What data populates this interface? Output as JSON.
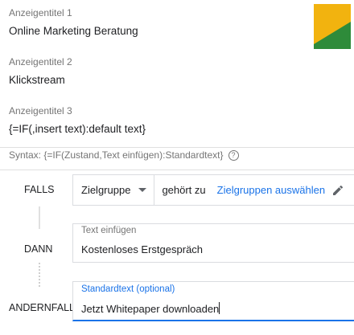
{
  "headlines": [
    {
      "label": "Anzeigentitel 1",
      "value": "Online Marketing Beratung"
    },
    {
      "label": "Anzeigentitel 2",
      "value": "Klickstream"
    },
    {
      "label": "Anzeigentitel 3",
      "value": "{=IF(,insert text):default text}"
    }
  ],
  "syntax": {
    "text": "Syntax: {=IF(Zustand,Text einfügen):Standardtext}",
    "help_icon": "help-circle-icon"
  },
  "falls": {
    "label": "FALLS",
    "dropdown_value": "Zielgruppe",
    "connector": "gehört zu",
    "link": "Zielgruppen auswählen",
    "edit_icon": "pencil-icon"
  },
  "dann": {
    "label": "DANN",
    "placeholder": "Text einfügen",
    "value": "Kostenloses Erstgespräch"
  },
  "andernfalls": {
    "label": "ANDERNFALLS",
    "placeholder": "Standardtext (optional)",
    "value": "Jetzt Whitepaper downloaden"
  },
  "colors": {
    "accent": "#1a73e8",
    "logo_yellow": "#f2b30f",
    "logo_green": "#2e8b3a"
  }
}
